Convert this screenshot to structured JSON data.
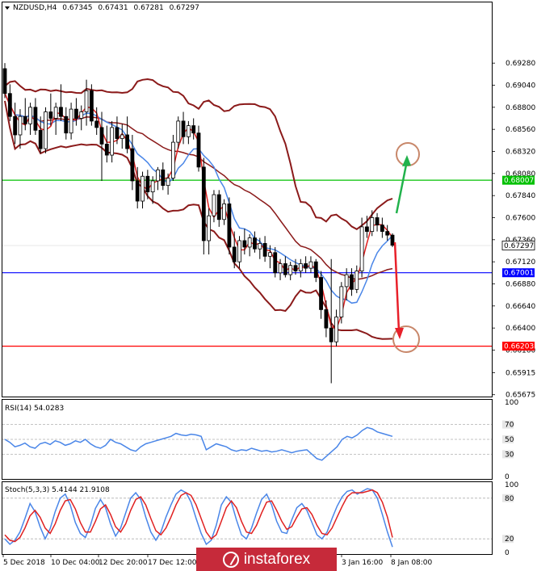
{
  "chart_data": [
    {
      "type": "candlestick",
      "panel": "price",
      "header": {
        "symbol": "NZDUSD,H4",
        "open": "0.67345",
        "high": "0.67431",
        "low": "0.67281",
        "close": "0.67297"
      },
      "ylim": [
        0.65655,
        0.6994
      ],
      "y_ticks": [
        "0.69280",
        "0.69040",
        "0.68800",
        "0.68560",
        "0.68320",
        "0.68080",
        "0.67840",
        "0.67600",
        "0.67360",
        "0.67120",
        "0.66880",
        "0.66640",
        "0.66400",
        "0.66160",
        "0.65915",
        "0.65675"
      ],
      "current_price": "0.67297",
      "levels": [
        {
          "label": "0.68007",
          "value": 0.68007,
          "color": "#00c000"
        },
        {
          "label": "0.67001",
          "value": 0.67001,
          "color": "#0000ff"
        },
        {
          "label": "0.66203",
          "value": 0.66203,
          "color": "#ff0000"
        }
      ],
      "candles_ohlc": [
        [
          0.6922,
          0.6928,
          0.689,
          0.6895
        ],
        [
          0.6895,
          0.6905,
          0.6865,
          0.687
        ],
        [
          0.687,
          0.6885,
          0.684,
          0.685
        ],
        [
          0.685,
          0.6878,
          0.6835,
          0.687
        ],
        [
          0.687,
          0.689,
          0.6855,
          0.6862
        ],
        [
          0.6862,
          0.6885,
          0.685,
          0.688
        ],
        [
          0.688,
          0.689,
          0.685,
          0.6855
        ],
        [
          0.6855,
          0.687,
          0.683,
          0.6835
        ],
        [
          0.6835,
          0.688,
          0.683,
          0.6875
        ],
        [
          0.6875,
          0.6895,
          0.686,
          0.6868
        ],
        [
          0.6868,
          0.6885,
          0.685,
          0.688
        ],
        [
          0.688,
          0.6905,
          0.6865,
          0.687
        ],
        [
          0.687,
          0.688,
          0.6845,
          0.6852
        ],
        [
          0.6852,
          0.6885,
          0.6845,
          0.6878
        ],
        [
          0.6878,
          0.689,
          0.686,
          0.6868
        ],
        [
          0.6868,
          0.6882,
          0.6855,
          0.6875
        ],
        [
          0.6875,
          0.691,
          0.686,
          0.6898
        ],
        [
          0.6898,
          0.6905,
          0.686,
          0.6865
        ],
        [
          0.6865,
          0.688,
          0.685,
          0.6858
        ],
        [
          0.6858,
          0.6875,
          0.68,
          0.684
        ],
        [
          0.684,
          0.686,
          0.682,
          0.6828
        ],
        [
          0.6828,
          0.6865,
          0.682,
          0.6858
        ],
        [
          0.6858,
          0.687,
          0.684,
          0.6846
        ],
        [
          0.6846,
          0.6862,
          0.6835,
          0.685
        ],
        [
          0.685,
          0.687,
          0.683,
          0.6835
        ],
        [
          0.6835,
          0.685,
          0.679,
          0.68
        ],
        [
          0.68,
          0.6815,
          0.677,
          0.6778
        ],
        [
          0.6778,
          0.681,
          0.677,
          0.6805
        ],
        [
          0.6805,
          0.6812,
          0.678,
          0.6788
        ],
        [
          0.6788,
          0.6805,
          0.6775,
          0.68
        ],
        [
          0.68,
          0.6815,
          0.679,
          0.6812
        ],
        [
          0.6812,
          0.682,
          0.679,
          0.6795
        ],
        [
          0.6795,
          0.6808,
          0.6785,
          0.6803
        ],
        [
          0.6803,
          0.685,
          0.68,
          0.6842
        ],
        [
          0.6842,
          0.687,
          0.6835,
          0.6865
        ],
        [
          0.6865,
          0.6875,
          0.684,
          0.6848
        ],
        [
          0.6848,
          0.6865,
          0.684,
          0.686
        ],
        [
          0.686,
          0.6868,
          0.6845,
          0.6852
        ],
        [
          0.6852,
          0.686,
          0.681,
          0.6815
        ],
        [
          0.6815,
          0.6825,
          0.672,
          0.6735
        ],
        [
          0.6735,
          0.677,
          0.672,
          0.6762
        ],
        [
          0.6762,
          0.679,
          0.6755,
          0.6785
        ],
        [
          0.6785,
          0.679,
          0.675,
          0.6758
        ],
        [
          0.6758,
          0.678,
          0.6752,
          0.6775
        ],
        [
          0.6775,
          0.6782,
          0.672,
          0.6728
        ],
        [
          0.6728,
          0.6745,
          0.6705,
          0.6712
        ],
        [
          0.6712,
          0.674,
          0.6705,
          0.6735
        ],
        [
          0.6735,
          0.6748,
          0.672,
          0.6728
        ],
        [
          0.6728,
          0.6742,
          0.6718,
          0.6738
        ],
        [
          0.6738,
          0.6745,
          0.6722,
          0.6726
        ],
        [
          0.6726,
          0.6738,
          0.6715,
          0.6732
        ],
        [
          0.6732,
          0.674,
          0.6712,
          0.6718
        ],
        [
          0.6718,
          0.673,
          0.6705,
          0.6722
        ],
        [
          0.6722,
          0.6728,
          0.6695,
          0.67
        ],
        [
          0.67,
          0.6715,
          0.6692,
          0.671
        ],
        [
          0.671,
          0.6718,
          0.6695,
          0.6698
        ],
        [
          0.6698,
          0.6712,
          0.6692,
          0.6708
        ],
        [
          0.6708,
          0.6715,
          0.6698,
          0.6702
        ],
        [
          0.6702,
          0.6715,
          0.6695,
          0.671
        ],
        [
          0.671,
          0.6718,
          0.67,
          0.6705
        ],
        [
          0.6705,
          0.6718,
          0.67,
          0.6712
        ],
        [
          0.6712,
          0.6715,
          0.669,
          0.6695
        ],
        [
          0.6695,
          0.6702,
          0.665,
          0.666
        ],
        [
          0.666,
          0.667,
          0.663,
          0.664
        ],
        [
          0.664,
          0.6715,
          0.658,
          0.6625
        ],
        [
          0.6625,
          0.666,
          0.662,
          0.6652
        ],
        [
          0.6652,
          0.669,
          0.6645,
          0.6685
        ],
        [
          0.6685,
          0.6705,
          0.667,
          0.6698
        ],
        [
          0.6698,
          0.6705,
          0.6675,
          0.6682
        ],
        [
          0.6682,
          0.6708,
          0.6678,
          0.6702
        ],
        [
          0.6702,
          0.676,
          0.6695,
          0.675
        ],
        [
          0.675,
          0.6762,
          0.6738,
          0.6745
        ],
        [
          0.6745,
          0.6768,
          0.674,
          0.676
        ],
        [
          0.676,
          0.6765,
          0.6745,
          0.6752
        ],
        [
          0.6752,
          0.676,
          0.6738,
          0.6745
        ],
        [
          0.6745,
          0.6752,
          0.6735,
          0.6741
        ],
        [
          0.6741,
          0.6743,
          0.6728,
          0.673
        ]
      ],
      "annotations": [
        "green-up-arrow",
        "red-down-arrow",
        "target-circle",
        "target-circle"
      ]
    },
    {
      "type": "line",
      "panel": "rsi",
      "label": "RSI(14) 54.0283",
      "ylim": [
        0,
        100
      ],
      "y_ticks": [
        "100",
        "70",
        "50",
        "30",
        "0"
      ],
      "levels": [
        70,
        50,
        30
      ],
      "values": [
        50,
        46,
        40,
        42,
        45,
        40,
        38,
        44,
        46,
        43,
        48,
        46,
        42,
        44,
        48,
        46,
        50,
        44,
        40,
        38,
        42,
        50,
        46,
        44,
        40,
        36,
        34,
        40,
        44,
        46,
        48,
        50,
        52,
        54,
        58,
        56,
        55,
        57,
        56,
        54,
        36,
        40,
        44,
        42,
        40,
        36,
        34,
        36,
        35,
        38,
        36,
        34,
        35,
        33,
        34,
        36,
        34,
        32,
        34,
        35,
        36,
        30,
        24,
        22,
        28,
        34,
        40,
        50,
        54,
        52,
        56,
        62,
        66,
        64,
        60,
        58,
        56,
        54
      ]
    },
    {
      "type": "line",
      "panel": "stochastic",
      "label": "Stoch(5,3,3) 5.4144 21.9108",
      "ylim": [
        0,
        100
      ],
      "y_ticks": [
        "100",
        "80",
        "20",
        "0"
      ],
      "levels": [
        80,
        20
      ],
      "series": [
        {
          "name": "main",
          "values": [
            20,
            12,
            18,
            30,
            50,
            72,
            60,
            38,
            20,
            35,
            60,
            80,
            86,
            70,
            44,
            28,
            22,
            40,
            65,
            78,
            66,
            42,
            24,
            36,
            58,
            80,
            88,
            78,
            52,
            30,
            18,
            30,
            52,
            70,
            86,
            92,
            88,
            74,
            50,
            28,
            12,
            18,
            40,
            70,
            82,
            74,
            48,
            26,
            20,
            36,
            58,
            78,
            86,
            70,
            46,
            30,
            28,
            48,
            66,
            72,
            62,
            44,
            26,
            20,
            30,
            50,
            68,
            82,
            90,
            92,
            86,
            90,
            94,
            92,
            80,
            56,
            30,
            8
          ]
        },
        {
          "name": "signal",
          "values": [
            26,
            18,
            16,
            22,
            36,
            54,
            62,
            52,
            36,
            28,
            42,
            62,
            76,
            78,
            64,
            44,
            30,
            30,
            46,
            64,
            70,
            56,
            38,
            30,
            42,
            62,
            78,
            82,
            70,
            50,
            32,
            26,
            36,
            52,
            70,
            84,
            88,
            84,
            70,
            50,
            30,
            20,
            26,
            46,
            66,
            76,
            66,
            46,
            30,
            28,
            40,
            58,
            74,
            76,
            62,
            46,
            34,
            38,
            52,
            64,
            66,
            56,
            40,
            28,
            26,
            36,
            52,
            68,
            82,
            88,
            88,
            88,
            90,
            92,
            88,
            74,
            52,
            22
          ]
        }
      ],
      "x_ticks": [
        "5 Dec 2018",
        "10 Dec 04:00",
        "12 Dec 20:00",
        "17 Dec 12:00",
        "3 Jan 16:00",
        "8 Jan 08:00"
      ]
    }
  ],
  "watermark": {
    "text": "instaforex"
  }
}
